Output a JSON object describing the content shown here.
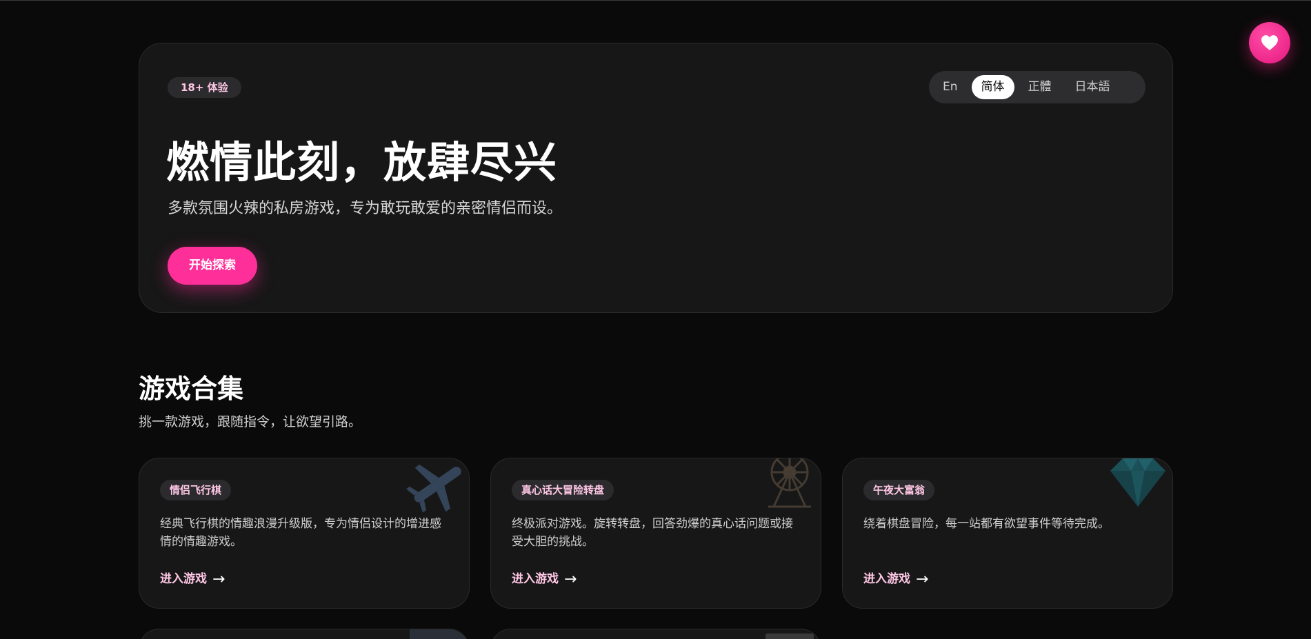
{
  "favorite": {
    "icon": "heart-icon"
  },
  "hero": {
    "badge": "18+ 体验",
    "title": "燃情此刻，放肆尽兴",
    "subtitle": "多款氛围火辣的私房游戏，专为敢玩敢爱的亲密情侣而设。",
    "cta_label": "开始探索",
    "languages": [
      {
        "label": "En",
        "active": false
      },
      {
        "label": "简体",
        "active": true
      },
      {
        "label": "正體",
        "active": false
      },
      {
        "label": "日本語",
        "active": false
      }
    ]
  },
  "section": {
    "title": "游戏合集",
    "subtitle": "挑一款游戏，跟随指令，让欲望引路。"
  },
  "games": [
    {
      "badge": "情侣飞行棋",
      "description": "经典飞行棋的情趣浪漫升级版，专为情侣设计的增进感情的情趣游戏。",
      "link_label": "进入游戏",
      "arrow": "→",
      "icon": "airplane-icon"
    },
    {
      "badge": "真心话大冒险转盘",
      "description": "终极派对游戏。旋转转盘，回答劲爆的真心话问题或接受大胆的挑战。",
      "link_label": "进入游戏",
      "arrow": "→",
      "icon": "ferris-wheel-icon"
    },
    {
      "badge": "午夜大富翁",
      "description": "绕着棋盘冒险，每一站都有欲望事件等待完成。",
      "link_label": "进入游戏",
      "arrow": "→",
      "icon": "gem-icon"
    }
  ],
  "colors": {
    "accent": "#ff2f9a",
    "badge_text": "#ffc7e6",
    "background": "#0a0a0a",
    "card": "#171717"
  }
}
